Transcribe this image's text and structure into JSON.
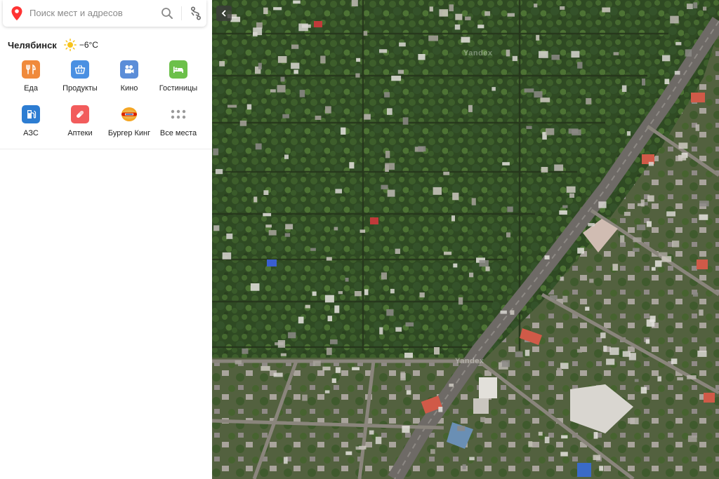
{
  "search": {
    "placeholder": "Поиск мест и адресов"
  },
  "weather": {
    "city": "Челябинск",
    "temperature": "−6°C"
  },
  "categories": [
    {
      "label": "Еда",
      "icon": "fork-knife-icon",
      "color": "#f08a3c"
    },
    {
      "label": "Продукты",
      "icon": "basket-icon",
      "color": "#4a90e2"
    },
    {
      "label": "Кино",
      "icon": "film-camera-icon",
      "color": "#5b8dd8"
    },
    {
      "label": "Гостиницы",
      "icon": "bed-icon",
      "color": "#6cc04a"
    },
    {
      "label": "АЗС",
      "icon": "fuel-pump-icon",
      "color": "#2d7dd2"
    },
    {
      "label": "Аптеки",
      "icon": "pill-icon",
      "color": "#f25c5c"
    },
    {
      "label": "Бургер Кинг",
      "icon": "burger-king-logo",
      "color": "#f5a623"
    },
    {
      "label": "Все места",
      "icon": "grid-dots-icon",
      "color": "#9a9a9a"
    }
  ],
  "map": {
    "view": "satellite",
    "watermark": "Yandex"
  }
}
